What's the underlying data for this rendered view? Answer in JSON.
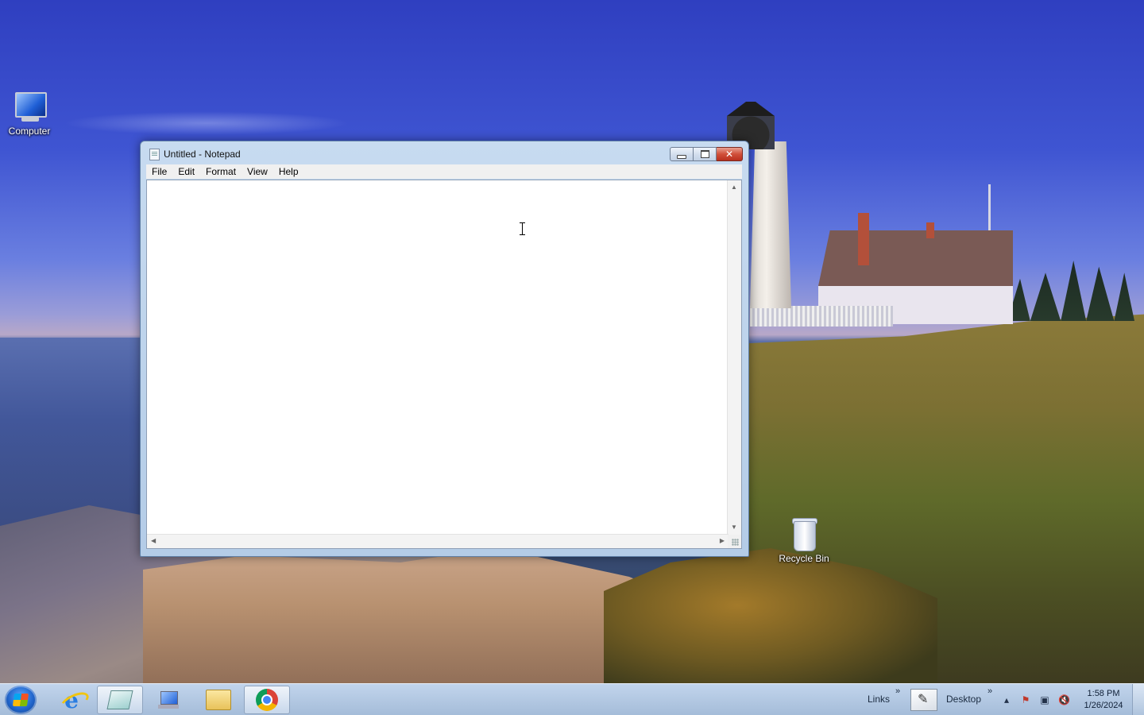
{
  "desktop": {
    "icons": [
      {
        "label": "Computer"
      },
      {
        "label": "Recycle Bin"
      }
    ]
  },
  "notepad": {
    "title": "Untitled - Notepad",
    "menu": [
      "File",
      "Edit",
      "Format",
      "View",
      "Help"
    ],
    "content": "",
    "controls": {
      "minimize": "minimize-icon",
      "maximize": "maximize-icon",
      "close": "close-icon"
    }
  },
  "taskbar": {
    "pinned": [
      "start-orb",
      "internet-explorer",
      "notepad",
      "remote-desktop",
      "windows-explorer",
      "google-chrome"
    ],
    "active_app": "notepad",
    "toolbars": [
      {
        "label": "Links"
      },
      {
        "label": "Desktop"
      }
    ],
    "tray_icons": [
      "show-hidden-icons",
      "action-center-flag",
      "network-icon",
      "volume-muted-icon"
    ],
    "clock": {
      "time": "1:58 PM",
      "date": "1/26/2024"
    }
  },
  "colors": {
    "close_button": "#d0503a",
    "taskbar": "#a8c0dd",
    "window_frame": "#b4cce7"
  }
}
